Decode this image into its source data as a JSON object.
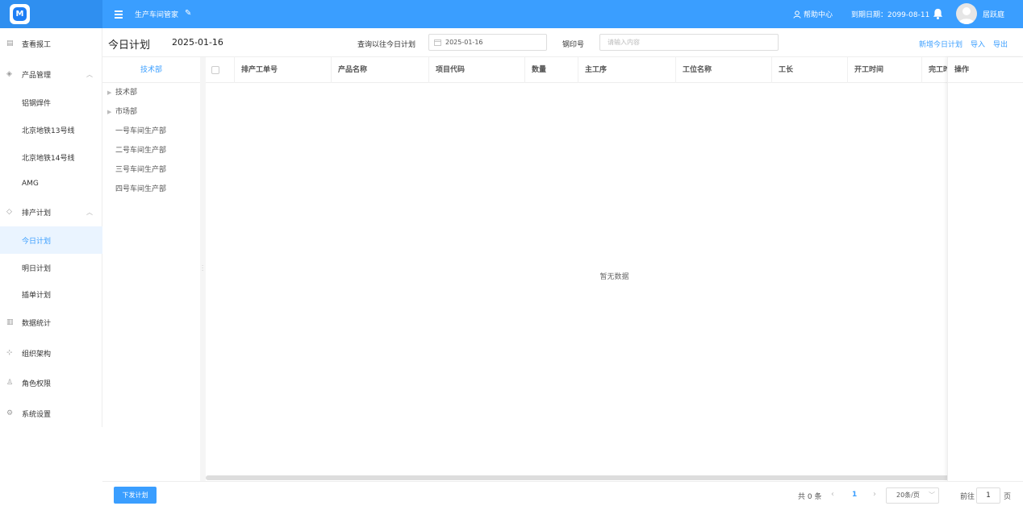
{
  "topbar": {
    "logo_letter": "M",
    "app_title": "生产车间管家",
    "help_label": "帮助中心",
    "expire_label": "到期日期：2099-08-11",
    "username": "居跃庭"
  },
  "sidebar": {
    "items": [
      {
        "label": "查看报工",
        "icon": "document-icon"
      },
      {
        "label": "产品管理",
        "icon": "cube-icon"
      },
      {
        "label": "铝钢焊件"
      },
      {
        "label": "北京地铁13号线"
      },
      {
        "label": "北京地铁14号线"
      },
      {
        "label": "AMG"
      },
      {
        "label": "排产计划",
        "icon": "layers-icon"
      },
      {
        "label": "今日计划",
        "active": true
      },
      {
        "label": "明日计划"
      },
      {
        "label": "插单计划"
      },
      {
        "label": "数据统计",
        "icon": "chart-icon"
      },
      {
        "label": "组织架构",
        "icon": "org-icon"
      },
      {
        "label": "角色权限",
        "icon": "user-icon"
      },
      {
        "label": "系统设置",
        "icon": "gear-icon"
      }
    ]
  },
  "header": {
    "title": "今日计划",
    "date": "2025-01-16",
    "query_label": "查询以往今日计划",
    "query_date": "2025-01-16",
    "steel_label": "钢印号",
    "steel_placeholder": "请输入内容",
    "action_add": "新增今日计划",
    "action_import": "导入",
    "action_export": "导出"
  },
  "departments": {
    "head": "技术部",
    "items": [
      {
        "label": "技术部",
        "expandable": true
      },
      {
        "label": "市场部",
        "expandable": true
      },
      {
        "label": "一号车间生产部"
      },
      {
        "label": "二号车间生产部"
      },
      {
        "label": "三号车间生产部"
      },
      {
        "label": "四号车间生产部"
      }
    ]
  },
  "table": {
    "columns": [
      "排产工单号",
      "产品名称",
      "项目代码",
      "数量",
      "主工序",
      "工位名称",
      "工长",
      "开工时间",
      "完工时间"
    ],
    "fixed_column": "操作",
    "empty_text": "暂无数据"
  },
  "footer": {
    "issue_button": "下发计划",
    "total": "共 0 条",
    "current_page": "1",
    "page_size": "20条/页",
    "goto_label": "前往",
    "goto_value": "1",
    "goto_unit": "页"
  },
  "colors": {
    "primary": "#3a9eff",
    "active_bg": "#eaf4ff"
  }
}
